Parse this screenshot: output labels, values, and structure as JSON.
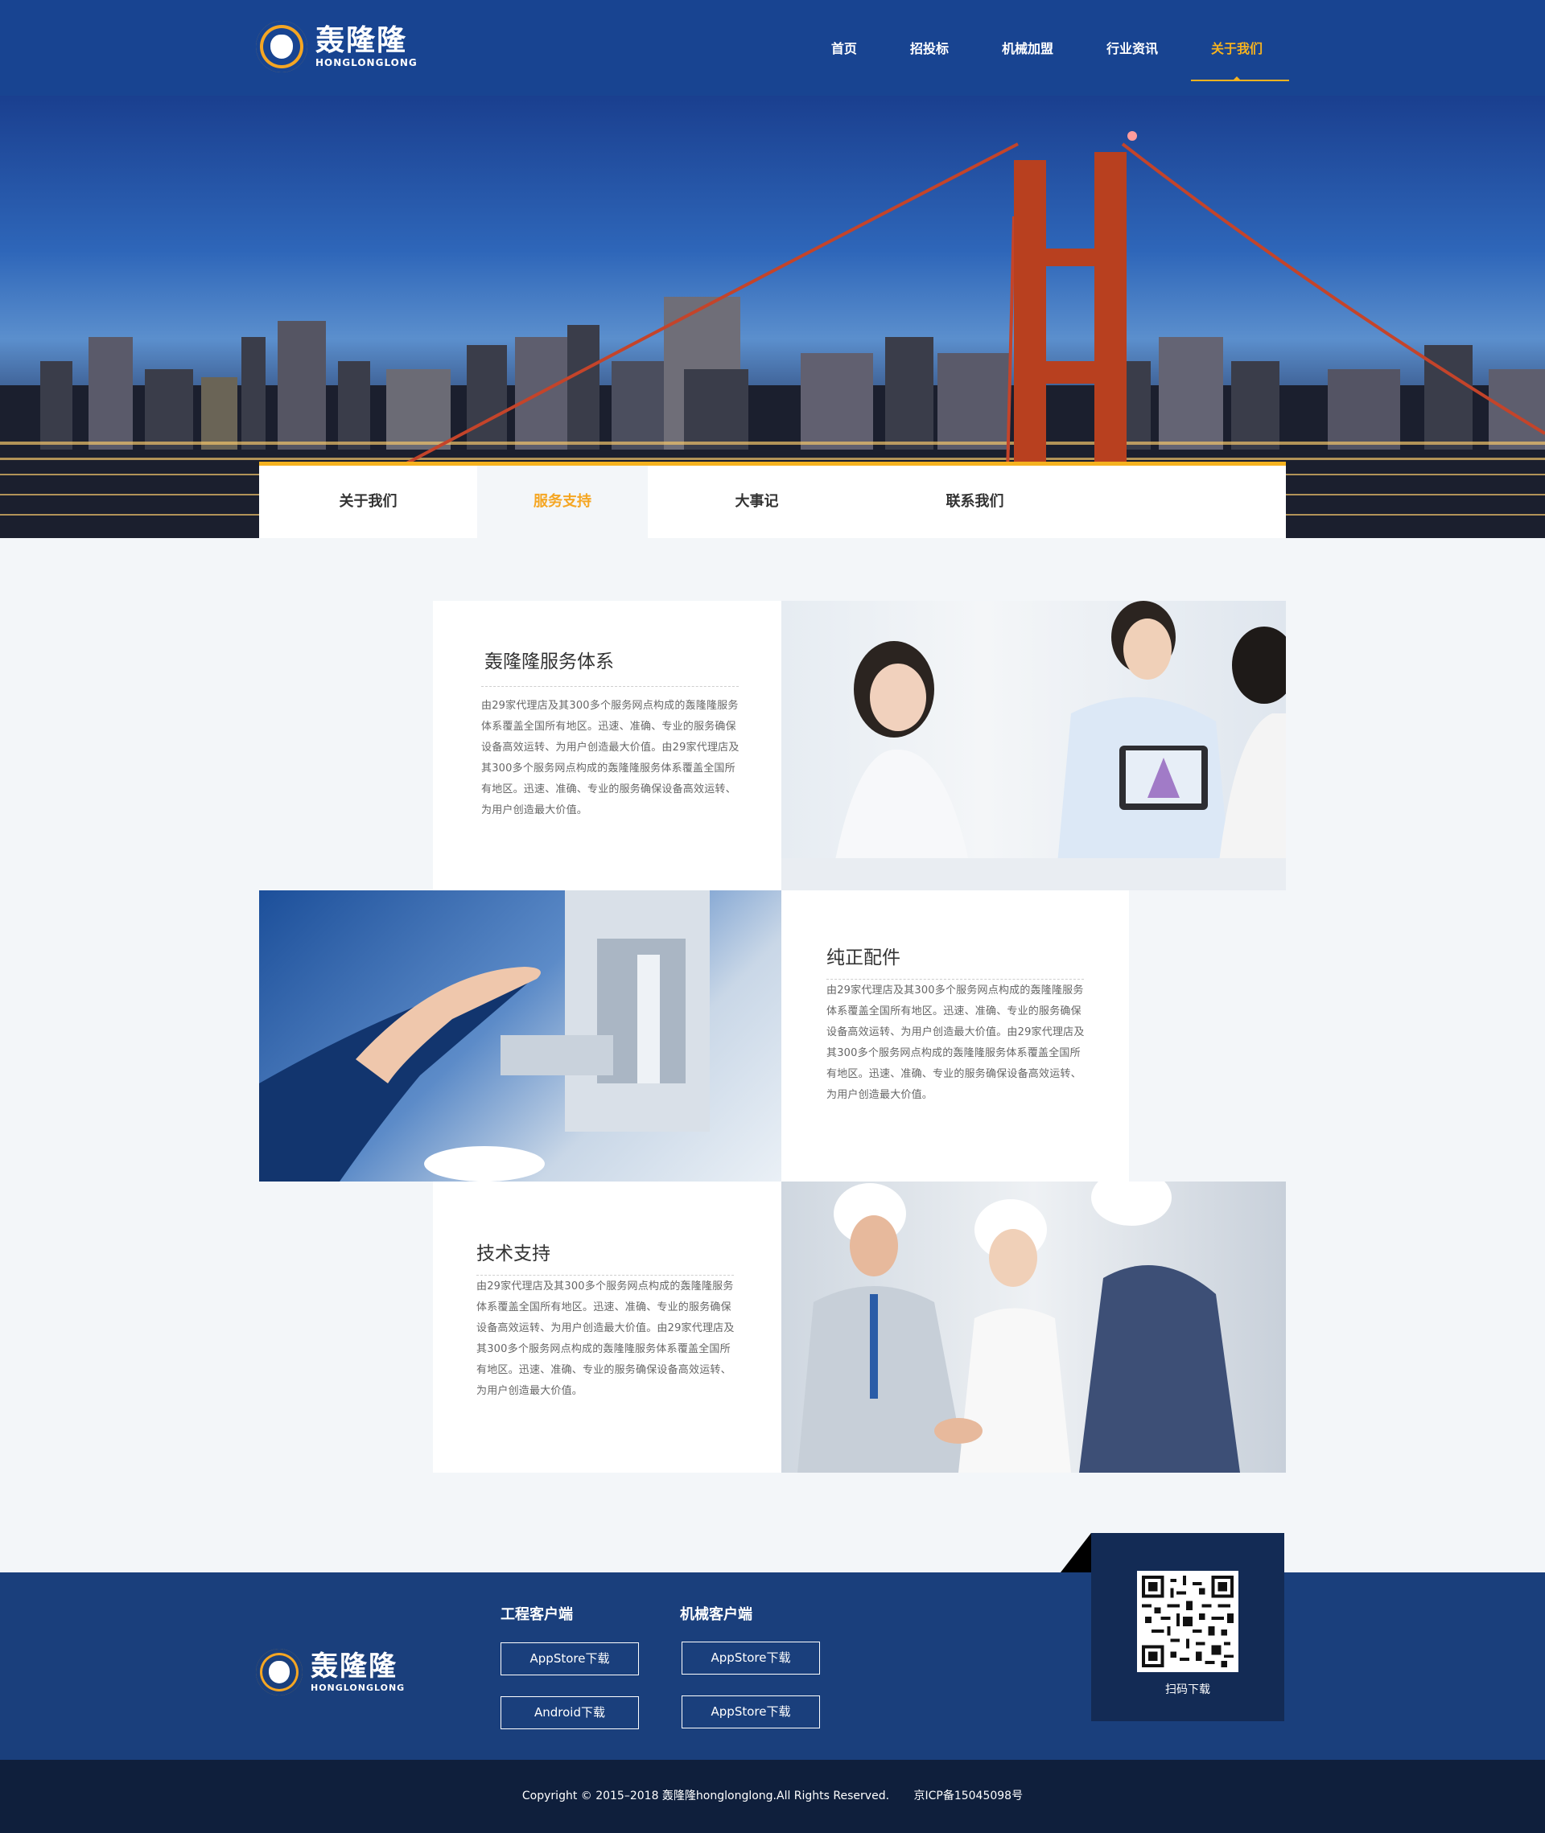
{
  "brand": {
    "name_cn": "轰隆隆",
    "name_en": "HONGLONGLONG",
    "accent_color": "#f5b21f",
    "primary_color": "#184491"
  },
  "nav": {
    "items": [
      {
        "label": "首页"
      },
      {
        "label": "招投标"
      },
      {
        "label": "机械加盟"
      },
      {
        "label": "行业资讯"
      },
      {
        "label": "关于我们",
        "active": true
      }
    ]
  },
  "subnav": {
    "items": [
      {
        "label": "关于我们"
      },
      {
        "label": "服务支持",
        "active": true
      },
      {
        "label": "大事记"
      },
      {
        "label": "联系我们"
      }
    ]
  },
  "services": [
    {
      "title": "轰隆隆服务体系",
      "body": "由29家代理店及其300多个服务网点构成的轰隆隆服务体系覆盖全国所有地区。迅速、准确、专业的服务确保设备高效运转、为用户创造最大价值。由29家代理店及其300多个服务网点构成的轰隆隆服务体系覆盖全国所有地区。迅速、准确、专业的服务确保设备高效运转、为用户创造最大价值。"
    },
    {
      "title": "纯正配件",
      "body": "由29家代理店及其300多个服务网点构成的轰隆隆服务体系覆盖全国所有地区。迅速、准确、专业的服务确保设备高效运转、为用户创造最大价值。由29家代理店及其300多个服务网点构成的轰隆隆服务体系覆盖全国所有地区。迅速、准确、专业的服务确保设备高效运转、为用户创造最大价值。"
    },
    {
      "title": "技术支持",
      "body": "由29家代理店及其300多个服务网点构成的轰隆隆服务体系覆盖全国所有地区。迅速、准确、专业的服务确保设备高效运转、为用户创造最大价值。由29家代理店及其300多个服务网点构成的轰隆隆服务体系覆盖全国所有地区。迅速、准确、专业的服务确保设备高效运转、为用户创造最大价值。"
    }
  ],
  "footer": {
    "apps": [
      {
        "title": "工程客户端",
        "buttons": [
          "AppStore下载",
          "Android下载"
        ]
      },
      {
        "title": "机械客户端",
        "buttons": [
          "AppStore下载",
          "AppStore下载"
        ]
      }
    ],
    "qr_label": "扫码下载",
    "copyright": "Copyright © 2015–2018 轰隆隆honglonglong.All Rights Reserved.",
    "icp": "京ICP备15045098号"
  }
}
